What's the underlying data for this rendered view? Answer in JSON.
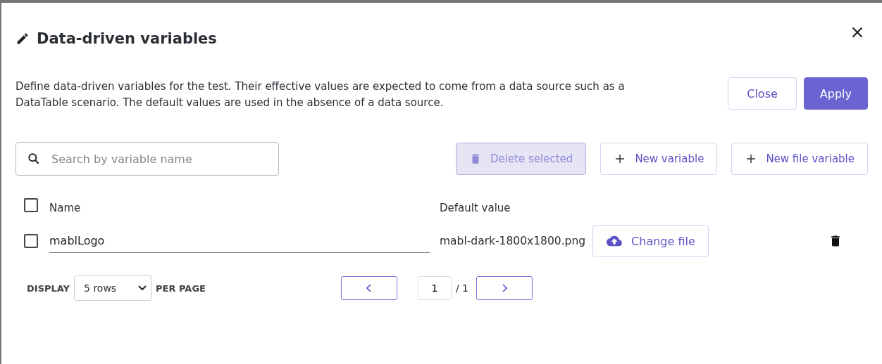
{
  "dialog": {
    "title": "Data-driven variables",
    "description": "Define data-driven variables for the test. Their effective values are expected to come from a data source such as a DataTable scenario. The default values are used in the absence of a data source.",
    "buttons": [
      {
        "label": "Close",
        "kind": "secondary"
      },
      {
        "label": "Apply",
        "kind": "primary"
      }
    ]
  },
  "toolbar": {
    "search": {
      "placeholder": "Search by variable name"
    },
    "actions": [
      {
        "label": "Delete selected",
        "kind": "delete",
        "disabled": true
      },
      {
        "label": "New variable",
        "kind": "add",
        "disabled": false
      },
      {
        "label": "New file variable",
        "kind": "add",
        "disabled": false
      }
    ]
  },
  "table": {
    "columns": [
      "Name",
      "Default value"
    ],
    "header_checked": false,
    "rows": [
      {
        "checked": false,
        "name": "mablLogo",
        "value": "mabl-dark-1800x1800.png",
        "action": "Change file"
      }
    ]
  },
  "pagination": {
    "display_label": "DISPLAY",
    "rows_option": "5 rows",
    "per_page_label": "PER PAGE",
    "page": "1",
    "total": "/ 1"
  }
}
